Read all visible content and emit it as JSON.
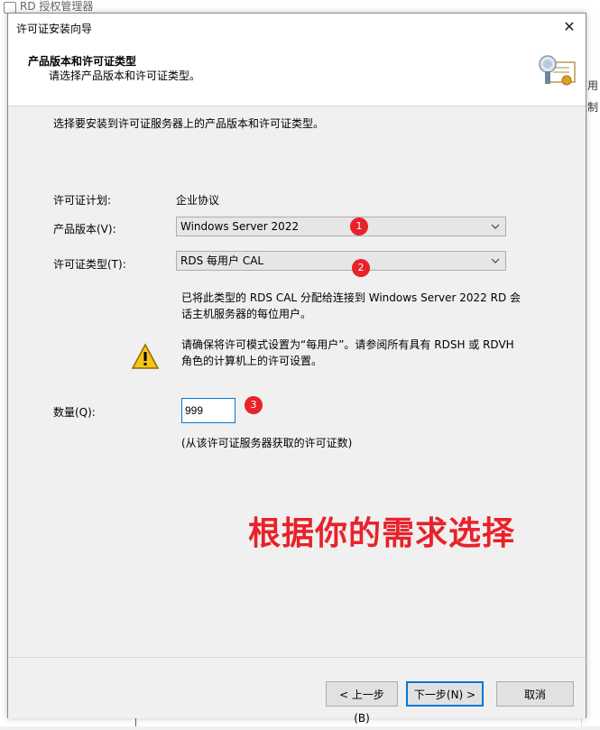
{
  "background": {
    "title": "RD 授权管理器",
    "right_texts": [
      "可用",
      "无限制"
    ]
  },
  "dialog": {
    "title": "许可证安装向导",
    "close_glyph": "✕"
  },
  "header": {
    "title": "产品版本和许可证类型",
    "subtitle": "请选择产品版本和许可证类型。"
  },
  "content": {
    "intro": "选择要安装到许可证服务器上的产品版本和许可证类型。",
    "license_plan_label": "许可证计划:",
    "license_plan_value": "企业协议",
    "product_version_label": "产品版本(V):",
    "product_version_value": "Windows Server 2022",
    "license_type_label": "许可证类型(T):",
    "license_type_value": "RDS 每用户 CAL",
    "license_type_description": "已将此类型的 RDS CAL 分配给连接到 Windows Server 2022 RD 会话主机服务器的每位用户。",
    "warning_text": "请确保将许可模式设置为“每用户”。请参阅所有具有 RDSH 或 RDVH 角色的计算机上的许可设置。",
    "quantity_label": "数量(Q):",
    "quantity_value": "999",
    "quantity_note": "(从该许可证服务器获取的许可证数)"
  },
  "annotations": {
    "badge1": "1",
    "badge2": "2",
    "badge3": "3",
    "overlay_text": "根据你的需求选择"
  },
  "footer": {
    "back_label": "< 上一步(B)",
    "next_label": "下一步(N) >",
    "cancel_label": "取消"
  },
  "colors": {
    "annotation_red": "#e8222a",
    "focus_blue": "#0078d7"
  }
}
